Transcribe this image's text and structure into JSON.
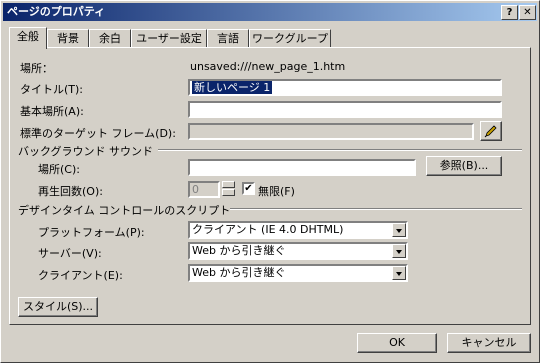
{
  "window": {
    "title": "ページのプロパティ",
    "help_btn": "?",
    "close_btn": "✕"
  },
  "tabs": [
    {
      "label": "全般"
    },
    {
      "label": "背景"
    },
    {
      "label": "余白"
    },
    {
      "label": "ユーザー設定"
    },
    {
      "label": "言語"
    },
    {
      "label": "ワークグループ"
    }
  ],
  "general": {
    "location_label": "場所：",
    "location_value": "unsaved:///new_page_1.htm",
    "title_label": "タイトル(T):",
    "title_value": "新しいページ 1",
    "base_label": "基本場所(A):",
    "base_value": "",
    "target_label": "標準のターゲット フレーム(D):",
    "target_value": "",
    "target_btn_icon": "pencil-icon"
  },
  "bgsound": {
    "group_label": "バックグラウンド サウンド",
    "location_label": "場所(C):",
    "location_value": "",
    "browse_btn": "参照(B)...",
    "loop_label": "再生回数(O):",
    "loop_value": "0",
    "infinite_label": "無限(F)",
    "infinite_checked": "✔"
  },
  "designtime": {
    "group_label": "デザインタイム コントロールのスクリプト",
    "platform_label": "プラットフォーム(P):",
    "platform_value": "クライアント (IE 4.0 DHTML)",
    "server_label": "サーバー(V):",
    "server_value": "Web から引き継ぐ",
    "client_label": "クライアント(E):",
    "client_value": "Web から引き継ぐ"
  },
  "style_btn": "スタイル(S)...",
  "ok_btn": "OK",
  "cancel_btn": "キャンセル"
}
